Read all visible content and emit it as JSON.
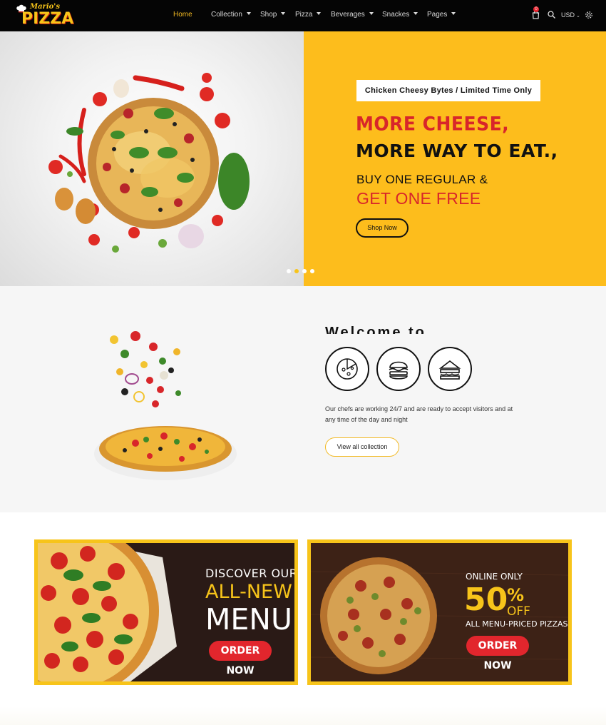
{
  "brand": {
    "script": "Mario's",
    "word": "PIZZA"
  },
  "nav": {
    "items": [
      {
        "label": "Home"
      },
      {
        "label": "Collection"
      },
      {
        "label": "Shop"
      },
      {
        "label": "Pizza"
      },
      {
        "label": "Beverages"
      },
      {
        "label": "Snackes"
      },
      {
        "label": "Pages"
      }
    ],
    "cart_count": "0",
    "currency": "USD"
  },
  "hero": {
    "tag": "Chicken Cheesy Bytes / Limited Time Only",
    "line1": "MORE CHEESE,",
    "line2": "MORE WAY TO EAT.,",
    "line3": "BUY ONE REGULAR &",
    "line4": "GET ONE FREE",
    "button": "Shop Now",
    "slides": 4,
    "active_slide": 2
  },
  "welcome": {
    "title": "Welcome to Pizzeria",
    "icons": [
      "pizza-icon",
      "burger-icon",
      "sandwich-icon"
    ],
    "text_line1": "Our chefs are working 24/7 and are ready to accept visitors and at",
    "text_line2": "any time of the day and night",
    "button": "View all collection"
  },
  "banners": [
    {
      "line1": "DISCOVER OUR",
      "line2": "ALL-NEW",
      "line3": "MENU",
      "button": "ORDER NOW"
    },
    {
      "line1": "ONLINE ONLY",
      "big": "50",
      "percent": "%",
      "off": "OFF",
      "line2": "ALL MENU-PRICED PIZZAS",
      "button": "ORDER NOW"
    }
  ],
  "colors": {
    "accent": "#fdbd1c",
    "red": "#d8262a",
    "dark": "#050505"
  }
}
